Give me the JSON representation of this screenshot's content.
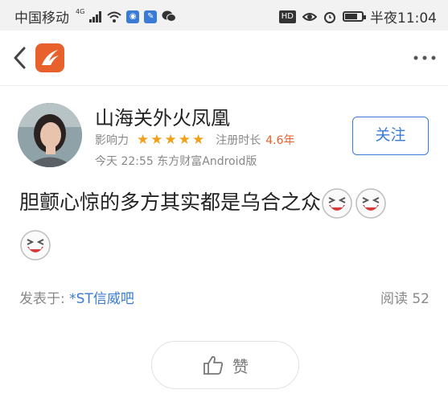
{
  "status_bar": {
    "carrier": "中国移动",
    "network": "4G",
    "time": "半夜11:04"
  },
  "author": {
    "name": "山海关外火凤凰",
    "influence_label": "影响力",
    "rating_stars": 5,
    "reg_label": "注册时长",
    "reg_value": "4.6年",
    "post_meta": "今天 22:55 东方财富Android版"
  },
  "follow_label": "关注",
  "post": {
    "text": "胆颤心惊的多方其实都是乌合之众",
    "emoji_count": 3
  },
  "footer": {
    "posted_in_label": "发表于:",
    "board_name": "*ST信威吧",
    "read_label": "阅读 52"
  },
  "like_label": "赞",
  "colors": {
    "brand_orange": "#e8602b",
    "link_blue": "#3a7bd5",
    "star": "#f0a01a"
  }
}
